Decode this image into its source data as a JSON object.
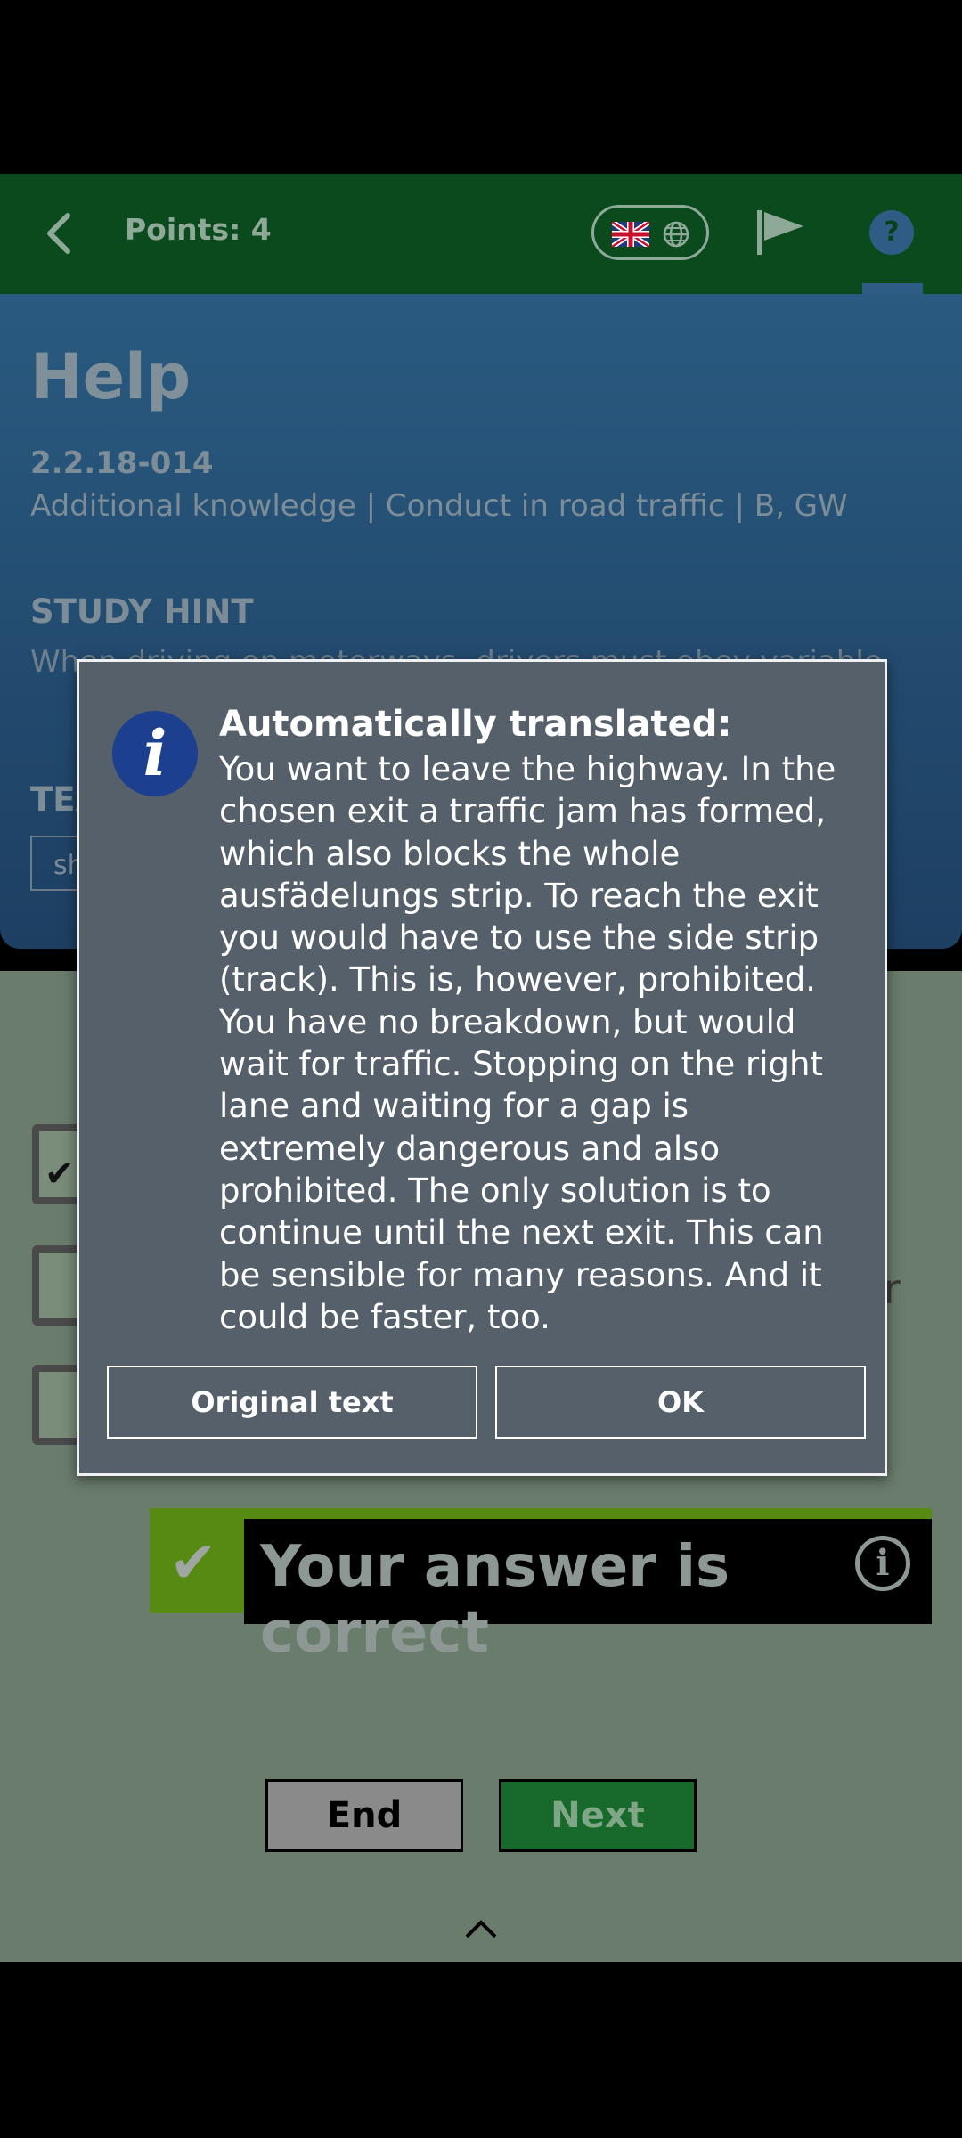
{
  "header": {
    "points_label": "Points: 4",
    "icons": [
      "back-arrow-icon",
      "uk-flag-icon",
      "globe-icon",
      "flag-icon",
      "help-icon"
    ]
  },
  "help_panel": {
    "title": "Help",
    "question_code": "2.2.18-014",
    "category": "Additional knowledge | Conduct in road traffic | B, GW",
    "study_hint_heading": "STUDY HINT",
    "study_hint_text": "When driving on motorways, drivers must obey variable",
    "teacher_heading": "TEA",
    "share_label": "sh"
  },
  "question": {
    "partial_answer_char": "r"
  },
  "result": {
    "text": "Your answer is correct",
    "info_glyph": "i",
    "check_glyph": "✔"
  },
  "buttons": {
    "end": "End",
    "next": "Next"
  },
  "dialog": {
    "title": "Automatically translated:",
    "body": "You want to leave the highway. In the chosen exit a traffic jam has formed, which also blocks the whole ausfädelungs strip. To reach the exit you would have to use the side strip (track). This is, however, prohibited. You have no breakdown, but would wait for traffic. Stopping on the right lane and waiting for a gap is extremely dangerous and also prohibited. The only solution is to continue until the next exit. This can be sensible for many reasons. And it could be faster, too.",
    "original_button": "Original text",
    "ok_button": "OK",
    "info_glyph": "i"
  },
  "colors": {
    "appbar": "#0a4a1d",
    "help_panel": "#2a5a80",
    "main": "#6a7c6c",
    "dialog": "#55606a",
    "correct_green": "#568a12",
    "next_button": "#176a2c"
  }
}
